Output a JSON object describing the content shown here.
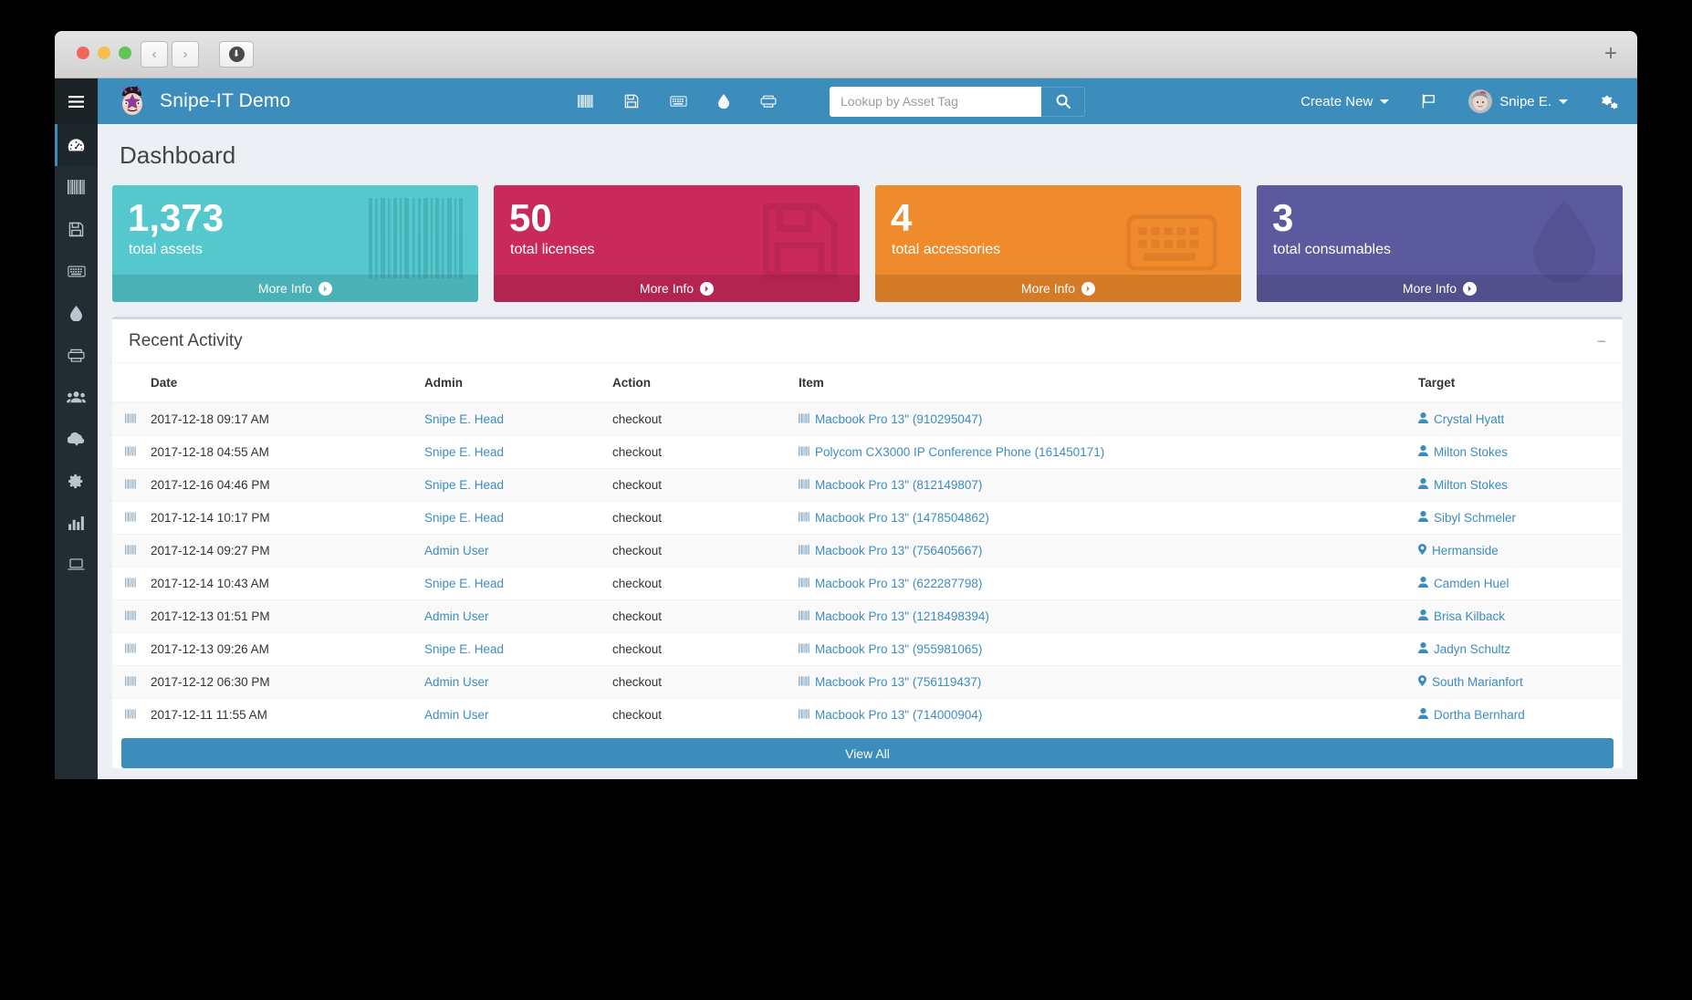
{
  "browser": {
    "back_label": "‹",
    "forward_label": "›",
    "download_label": "⬇",
    "new_tab_label": "+"
  },
  "sidebar": {
    "menu_toggle_icon": "hamburger-icon",
    "items": [
      {
        "icon": "dashboard-icon",
        "name": "dashboard",
        "active": true
      },
      {
        "icon": "barcode-icon",
        "name": "assets",
        "active": false
      },
      {
        "icon": "floppy-icon",
        "name": "licenses",
        "active": false
      },
      {
        "icon": "keyboard-icon",
        "name": "accessories",
        "active": false
      },
      {
        "icon": "tint-icon",
        "name": "consumables",
        "active": false
      },
      {
        "icon": "printer-icon",
        "name": "components",
        "active": false
      },
      {
        "icon": "users-icon",
        "name": "people",
        "active": false
      },
      {
        "icon": "cloud-download-icon",
        "name": "import",
        "active": false
      },
      {
        "icon": "gear-icon",
        "name": "settings",
        "active": false
      },
      {
        "icon": "chart-icon",
        "name": "reports",
        "active": false
      },
      {
        "icon": "laptop-icon",
        "name": "requestable",
        "active": false
      }
    ]
  },
  "header": {
    "brand": "Snipe-IT Demo",
    "brand_logo_icon": "snipe-mascot-logo",
    "quick_icons": [
      {
        "icon": "barcode-icon",
        "name": "quick-assets"
      },
      {
        "icon": "floppy-icon",
        "name": "quick-licenses"
      },
      {
        "icon": "keyboard-icon",
        "name": "quick-accessories"
      },
      {
        "icon": "tint-icon",
        "name": "quick-consumables"
      },
      {
        "icon": "printer-icon",
        "name": "quick-components"
      }
    ],
    "search": {
      "placeholder": "Lookup by Asset Tag",
      "value": "",
      "button_icon": "search-icon"
    },
    "create_new": "Create New",
    "flag_icon": "flag-icon",
    "user_name": "Snipe E.",
    "avatar_icon": "user-avatar",
    "settings_icon": "gears-icon"
  },
  "page": {
    "title": "Dashboard"
  },
  "cards": [
    {
      "value": "1,373",
      "label": "total assets",
      "more": "More Info",
      "color": "#54c8cd",
      "icon": "barcode-icon",
      "theme": "aqua"
    },
    {
      "value": "50",
      "label": "total licenses",
      "more": "More Info",
      "color": "#c9295b",
      "icon": "floppy-icon",
      "theme": "red"
    },
    {
      "value": "4",
      "label": "total accessories",
      "more": "More Info",
      "color": "#ef8b2c",
      "icon": "keyboard-icon",
      "theme": "orange"
    },
    {
      "value": "3",
      "label": "total consumables",
      "more": "More Info",
      "color": "#5c5a9e",
      "icon": "tint-icon",
      "theme": "purple"
    }
  ],
  "activity": {
    "title": "Recent Activity",
    "collapse_icon": "minus-icon",
    "columns": [
      "",
      "Date",
      "Admin",
      "Action",
      "Item",
      "Target"
    ],
    "rows": [
      {
        "date": "2017-12-18 09:17 AM",
        "admin": "Snipe E. Head",
        "action": "checkout",
        "item": "Macbook Pro 13\" (910295047)",
        "item_icon": "barcode-icon",
        "target": "Crystal Hyatt",
        "target_icon": "user-icon"
      },
      {
        "date": "2017-12-18 04:55 AM",
        "admin": "Snipe E. Head",
        "action": "checkout",
        "item": "Polycom CX3000 IP Conference Phone (161450171)",
        "item_icon": "barcode-icon",
        "target": "Milton Stokes",
        "target_icon": "user-icon"
      },
      {
        "date": "2017-12-16 04:46 PM",
        "admin": "Snipe E. Head",
        "action": "checkout",
        "item": "Macbook Pro 13\" (812149807)",
        "item_icon": "barcode-icon",
        "target": "Milton Stokes",
        "target_icon": "user-icon"
      },
      {
        "date": "2017-12-14 10:17 PM",
        "admin": "Snipe E. Head",
        "action": "checkout",
        "item": "Macbook Pro 13\" (1478504862)",
        "item_icon": "barcode-icon",
        "target": "Sibyl Schmeler",
        "target_icon": "user-icon"
      },
      {
        "date": "2017-12-14 09:27 PM",
        "admin": "Admin User",
        "action": "checkout",
        "item": "Macbook Pro 13\" (756405667)",
        "item_icon": "barcode-icon",
        "target": "Hermanside",
        "target_icon": "map-marker-icon"
      },
      {
        "date": "2017-12-14 10:43 AM",
        "admin": "Snipe E. Head",
        "action": "checkout",
        "item": "Macbook Pro 13\" (622287798)",
        "item_icon": "barcode-icon",
        "target": "Camden Huel",
        "target_icon": "user-icon"
      },
      {
        "date": "2017-12-13 01:51 PM",
        "admin": "Admin User",
        "action": "checkout",
        "item": "Macbook Pro 13\" (1218498394)",
        "item_icon": "barcode-icon",
        "target": "Brisa Kilback",
        "target_icon": "user-icon"
      },
      {
        "date": "2017-12-13 09:26 AM",
        "admin": "Snipe E. Head",
        "action": "checkout",
        "item": "Macbook Pro 13\" (955981065)",
        "item_icon": "barcode-icon",
        "target": "Jadyn Schultz",
        "target_icon": "user-icon"
      },
      {
        "date": "2017-12-12 06:30 PM",
        "admin": "Admin User",
        "action": "checkout",
        "item": "Macbook Pro 13\" (756119437)",
        "item_icon": "barcode-icon",
        "target": "South Marianfort",
        "target_icon": "map-marker-icon"
      },
      {
        "date": "2017-12-11 11:55 AM",
        "admin": "Admin User",
        "action": "checkout",
        "item": "Macbook Pro 13\" (714000904)",
        "item_icon": "barcode-icon",
        "target": "Dortha Bernhard",
        "target_icon": "user-icon"
      }
    ],
    "view_all": "View All"
  },
  "colors": {
    "header_blue": "#3c8dbc",
    "sidebar_dark": "#222d32",
    "link_blue": "#3c8dbc",
    "page_bg": "#ecf0f5"
  }
}
